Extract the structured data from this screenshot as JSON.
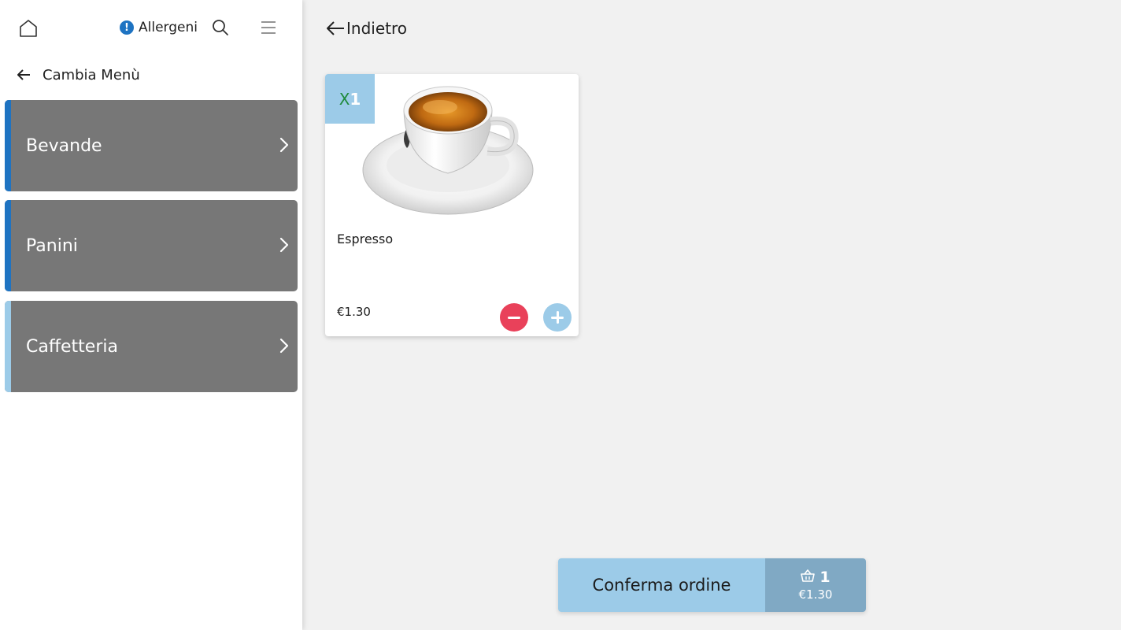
{
  "header": {
    "allergens_label": "Allergeni",
    "allergens_info_glyph": "!",
    "change_menu_label": "Cambia Menù"
  },
  "icons": {
    "home": "home-icon",
    "search": "search-icon",
    "menu": "hamburger-menu-icon",
    "back": "arrow-left-icon",
    "chevron": "chevron-right-icon",
    "basket": "basket-icon",
    "info": "info-icon"
  },
  "sidebar": {
    "categories": [
      {
        "label": "Bevande",
        "stripe_color": "#1e73c2"
      },
      {
        "label": "Panini",
        "stripe_color": "#1e73c2"
      },
      {
        "label": "Caffetteria",
        "stripe_color": "#9ccbe8"
      }
    ]
  },
  "main": {
    "back_label": "Indietro",
    "product": {
      "qty_prefix": "X",
      "qty": "1",
      "name": "Espresso",
      "price": "€1.30"
    }
  },
  "order": {
    "confirm_label": "Conferma ordine",
    "item_count": "1",
    "total": "€1.30"
  },
  "colors": {
    "accent": "#9ccbe8",
    "accent_dark": "#80a9c4",
    "category_bg": "#777777",
    "minus": "#e9415a",
    "primary_blue": "#1e73c2"
  }
}
